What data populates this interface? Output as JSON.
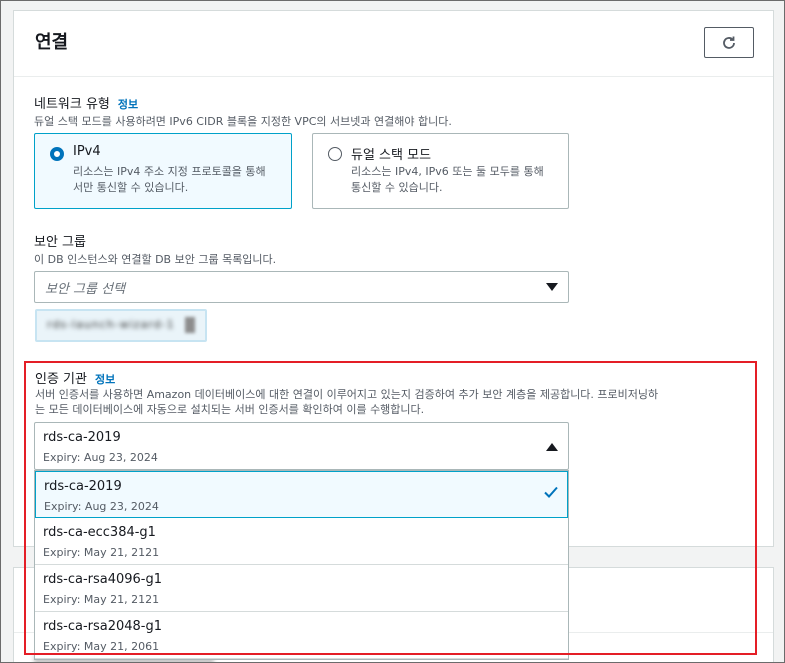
{
  "panel": {
    "title": "연결",
    "refresh_icon": "refresh-icon"
  },
  "network_type": {
    "label": "네트워크 유형",
    "info": "정보",
    "description": "듀얼 스택 모드를 사용하려면 IPv6 CIDR 블록을 지정한 VPC의 서브넷과 연결해야 합니다.",
    "options": [
      {
        "title": "IPv4",
        "desc": "리소스는 IPv4 주소 지정 프로토콜을 통해서만 통신할 수 있습니다.",
        "selected": true
      },
      {
        "title": "듀얼 스택 모드",
        "desc": "리소스는 IPv4, IPv6 또는 둘 모두를 통해 통신할 수 있습니다.",
        "selected": false
      }
    ]
  },
  "security_group": {
    "label": "보안 그룹",
    "description": "이 DB 인스턴스와 연결할 DB 보안 그룹 목록입니다.",
    "placeholder": "보안 그룹 선택",
    "chip": "rds-launch-wizard-1"
  },
  "ca": {
    "label": "인증 기관",
    "info": "정보",
    "description_line1": "서버 인증서를 사용하면 Amazon 데이터베이스에 대한 연결이 이루어지고 있는지 검증하여 추가 보안 계층을 제공합니다. 프로비저닝하",
    "description_line2": "는 모든 데이터베이스에 자동으로 설치되는 서버 인증서를 확인하여 이를 수행합니다.",
    "selected": {
      "name": "rds-ca-2019",
      "expiry": "Expiry: Aug 23, 2024"
    },
    "options": [
      {
        "name": "rds-ca-2019",
        "expiry": "Expiry: Aug 23, 2024",
        "selected": true
      },
      {
        "name": "rds-ca-ecc384-g1",
        "expiry": "Expiry: May 21, 2121",
        "selected": false
      },
      {
        "name": "rds-ca-rsa4096-g1",
        "expiry": "Expiry: May 21, 2121",
        "selected": false
      },
      {
        "name": "rds-ca-rsa2048-g1",
        "expiry": "Expiry: May 21, 2061",
        "selected": false
      }
    ]
  },
  "colors": {
    "accent": "#0073bb",
    "highlight": "#e41e26"
  }
}
